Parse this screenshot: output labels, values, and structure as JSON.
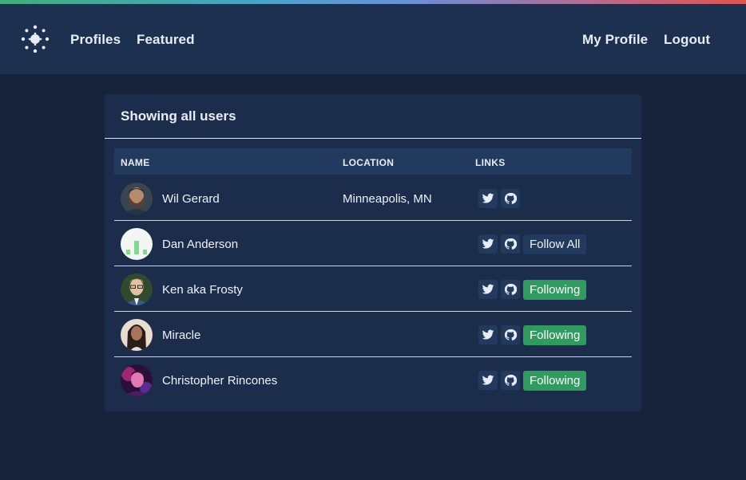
{
  "nav": {
    "left_links": [
      "Profiles",
      "Featured"
    ],
    "right_links": [
      "My Profile",
      "Logout"
    ]
  },
  "card": {
    "title": "Showing all users",
    "columns": [
      "NAME",
      "LOCATION",
      "LINKS"
    ]
  },
  "users": [
    {
      "name": "Wil Gerard",
      "location": "Minneapolis, MN",
      "action": "",
      "avatar": "bearded-man-photo"
    },
    {
      "name": "Dan Anderson",
      "location": "",
      "action": "Follow All",
      "avatar": "green-bars-logo"
    },
    {
      "name": "Ken aka Frosty",
      "location": "",
      "action": "Following",
      "avatar": "man-with-glasses-photo"
    },
    {
      "name": "Miracle",
      "location": "",
      "action": "Following",
      "avatar": "woman-long-hair-photo"
    },
    {
      "name": "Christopher Rincones",
      "location": "",
      "action": "Following",
      "avatar": "pink-lit-portrait-photo"
    }
  ],
  "icons": {
    "social": [
      "twitter-icon",
      "github-icon"
    ],
    "logo": "sun-logo"
  },
  "colors": {
    "background": "#17233b",
    "navbar": "#1d3050",
    "card": "#1c2d4b",
    "following": "#2f9b5f"
  }
}
